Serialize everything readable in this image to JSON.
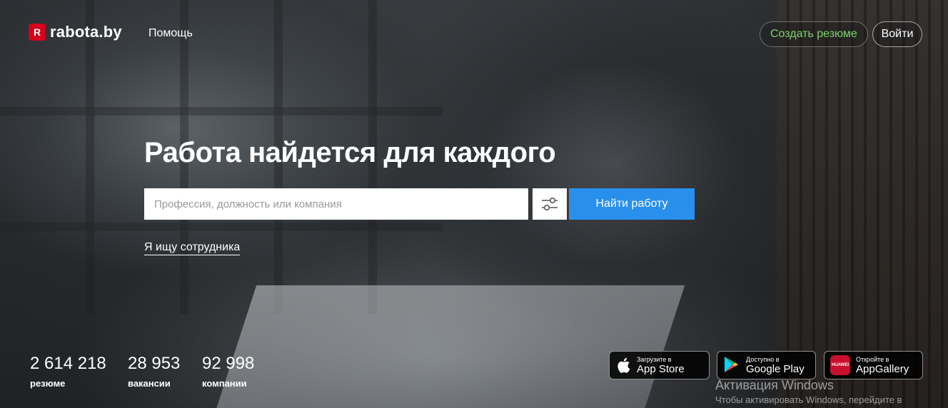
{
  "header": {
    "logo_mark": "R",
    "logo_text": "rabota.by",
    "help_label": "Помощь",
    "create_resume_label": "Создать резюме",
    "login_label": "Войти"
  },
  "hero": {
    "title": "Работа найдется для каждого",
    "search_placeholder": "Профессия, должность или компания",
    "search_button_label": "Найти работу",
    "filter_icon": "sliders-icon",
    "employer_link_label": "Я ищу сотрудника"
  },
  "stats": [
    {
      "value": "2 614 218",
      "label": "резюме"
    },
    {
      "value": "28 953",
      "label": "вакансии"
    },
    {
      "value": "92 998",
      "label": "компании"
    }
  ],
  "stores": {
    "apple": {
      "sub": "Загрузите в",
      "main": "App Store"
    },
    "google": {
      "sub": "Доступно в",
      "main": "Google Play"
    },
    "huawei": {
      "sub": "Откройте в",
      "main": "AppGallery",
      "logo_text": "HUAWEI"
    }
  },
  "watermark": {
    "line1": "Активация Windows",
    "line2": "Чтобы активировать Windows, перейдите в"
  },
  "colors": {
    "accent_blue": "#2890ec",
    "brand_red": "#d6001c",
    "resume_green": "#7ad36a"
  }
}
